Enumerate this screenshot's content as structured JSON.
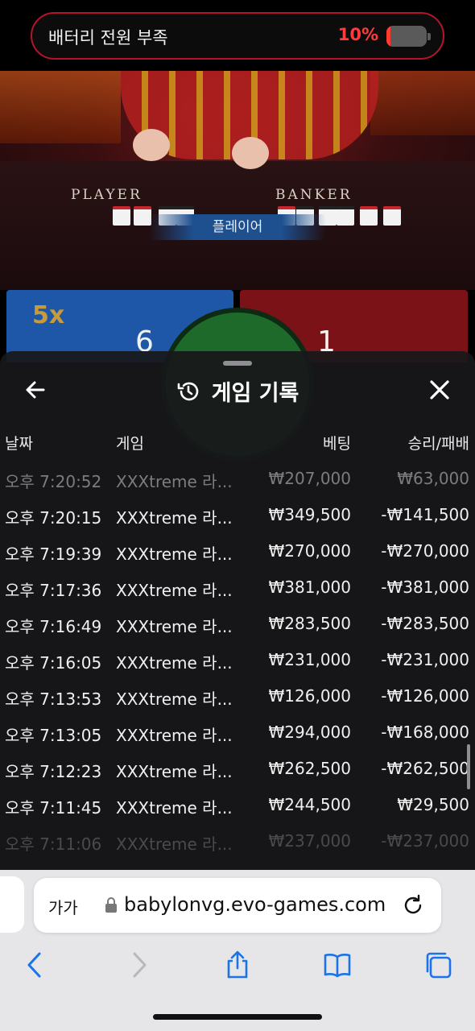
{
  "status_banner": {
    "message": "배터리 전원 부족",
    "percent_label": "10%",
    "level": 0.1,
    "accent_color": "#ff3b30"
  },
  "game_view": {
    "player_label": "PLAYER",
    "banker_label": "BANKER",
    "result_label": "플레이어",
    "multiplier": "5x",
    "player_score": "6",
    "banker_score": "1"
  },
  "history_sheet": {
    "title": "게임 기록",
    "icons": {
      "back": "arrow-left-icon",
      "history": "history-clock-icon",
      "close": "close-x-icon"
    },
    "columns": {
      "date": "날짜",
      "game": "게임",
      "bet": "베팅",
      "win_loss": "승리/패배"
    },
    "rows": [
      {
        "time": "오후 7:20:52",
        "game": "XXXtreme 라...",
        "bet": "₩207,000",
        "result": "₩63,000"
      },
      {
        "time": "오후 7:20:15",
        "game": "XXXtreme 라...",
        "bet": "₩349,500",
        "result": "-₩141,500"
      },
      {
        "time": "오후 7:19:39",
        "game": "XXXtreme 라...",
        "bet": "₩270,000",
        "result": "-₩270,000"
      },
      {
        "time": "오후 7:17:36",
        "game": "XXXtreme 라...",
        "bet": "₩381,000",
        "result": "-₩381,000"
      },
      {
        "time": "오후 7:16:49",
        "game": "XXXtreme 라...",
        "bet": "₩283,500",
        "result": "-₩283,500"
      },
      {
        "time": "오후 7:16:05",
        "game": "XXXtreme 라...",
        "bet": "₩231,000",
        "result": "-₩231,000"
      },
      {
        "time": "오후 7:13:53",
        "game": "XXXtreme 라...",
        "bet": "₩126,000",
        "result": "-₩126,000"
      },
      {
        "time": "오후 7:13:05",
        "game": "XXXtreme 라...",
        "bet": "₩294,000",
        "result": "-₩168,000"
      },
      {
        "time": "오후 7:12:23",
        "game": "XXXtreme 라...",
        "bet": "₩262,500",
        "result": "-₩262,500"
      },
      {
        "time": "오후 7:11:45",
        "game": "XXXtreme 라...",
        "bet": "₩244,500",
        "result": "₩29,500"
      },
      {
        "time": "오후 7:11:06",
        "game": "XXXtreme 라...",
        "bet": "₩237,000",
        "result": "-₩237,000"
      }
    ]
  },
  "browser": {
    "text_size_label": "가가",
    "url": "babylonvg.evo-games.com",
    "icons": [
      "back-icon",
      "forward-icon",
      "share-icon",
      "bookmarks-icon",
      "tabs-icon"
    ]
  }
}
